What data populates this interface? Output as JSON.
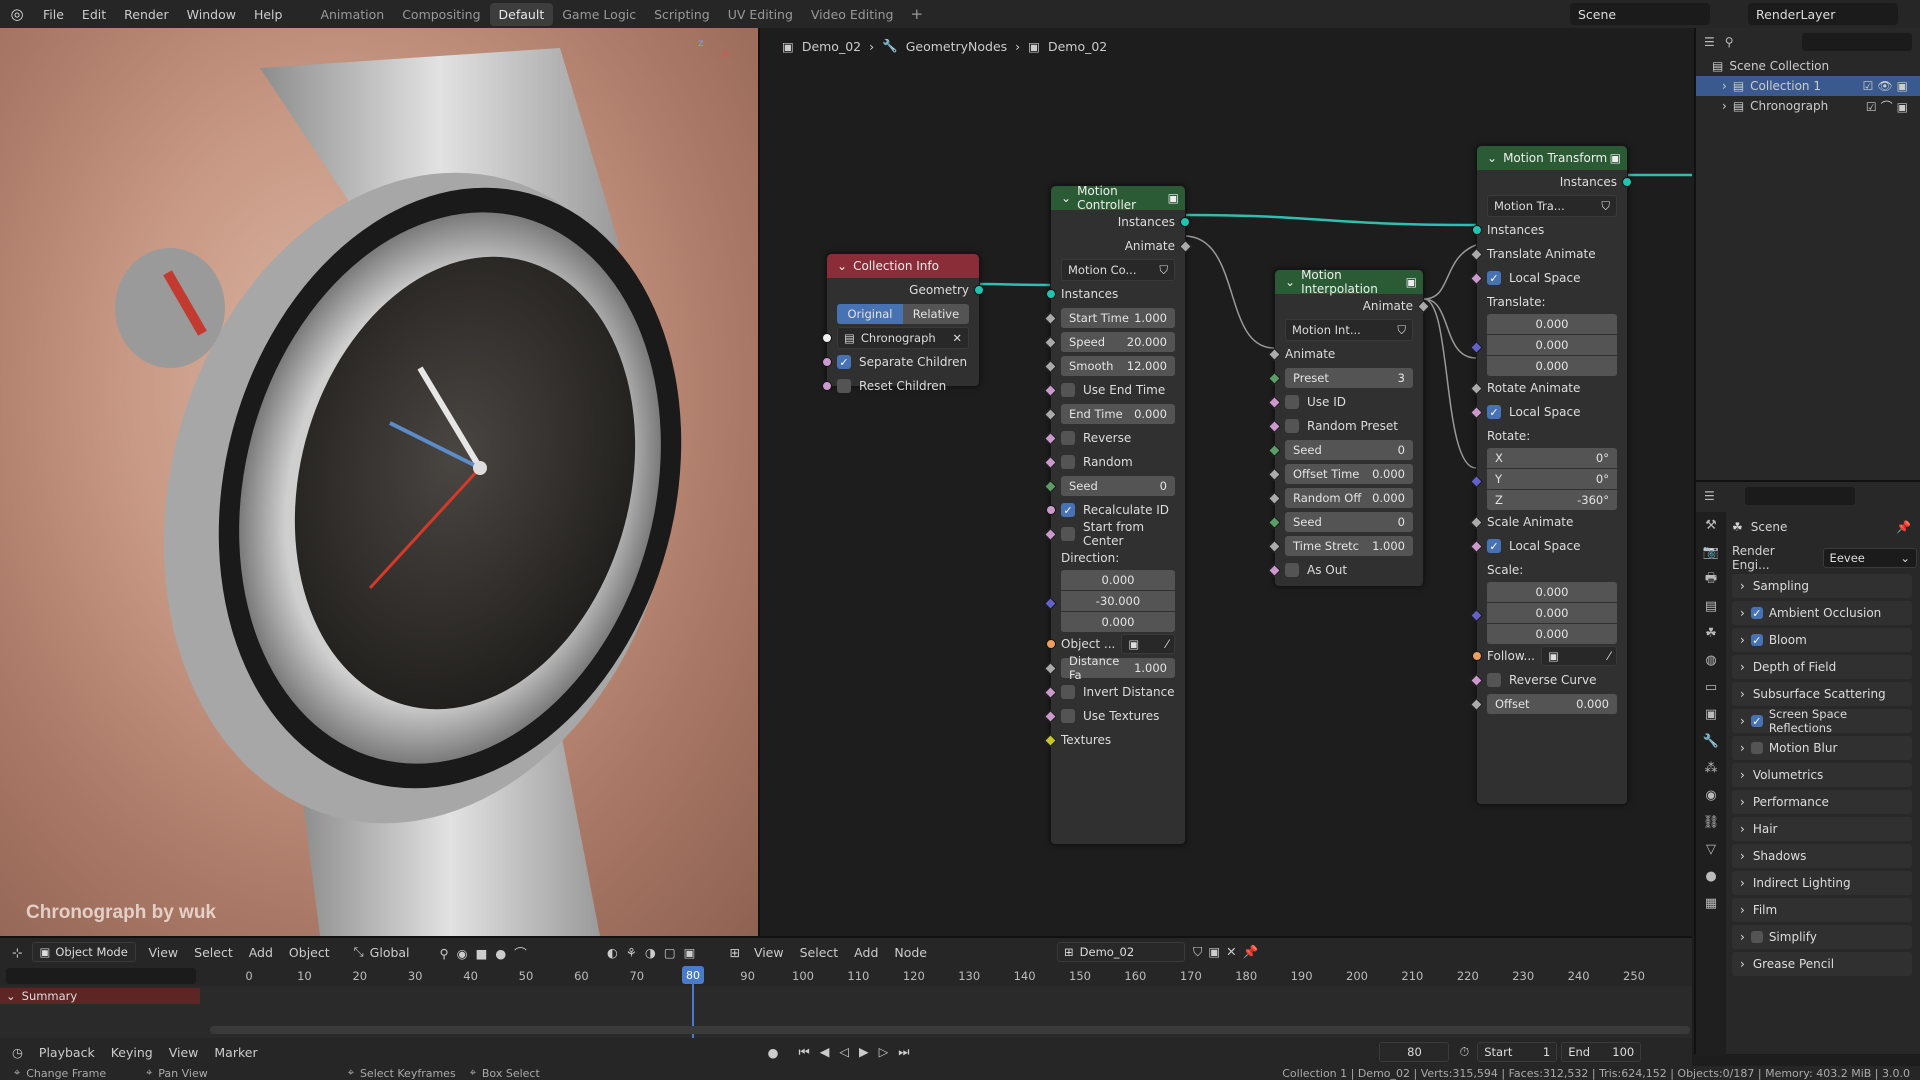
{
  "menu": {
    "items": [
      "File",
      "Edit",
      "Render",
      "Window",
      "Help"
    ]
  },
  "workspaces": [
    "Animation",
    "Compositing",
    "Default",
    "Game Logic",
    "Scripting",
    "UV Editing",
    "Video Editing"
  ],
  "active_workspace": "Default",
  "scene_name": "Scene",
  "render_layer": "RenderLayer",
  "viewport": {
    "credit": "Chronograph by wuk",
    "mode": "Object Mode",
    "menus": [
      "View",
      "Select",
      "Add",
      "Object"
    ],
    "transform": "Global"
  },
  "node_editor": {
    "breadcrumb": [
      "Demo_02",
      "GeometryNodes",
      "Demo_02"
    ],
    "menus": [
      "View",
      "Select",
      "Add",
      "Node"
    ],
    "tree_name": "Demo_02",
    "collection_info": {
      "title": "Collection Info",
      "geometry": "Geometry",
      "btn_original": "Original",
      "btn_relative": "Relative",
      "collection": "Chronograph",
      "separate_children": "Separate Children",
      "reset_children": "Reset Children"
    },
    "motion_controller": {
      "title": "Motion Controller",
      "instances": "Instances",
      "animate": "Animate",
      "group": "Motion Co...",
      "in_instances": "Instances",
      "start_time_l": "Start Time",
      "start_time": "1.000",
      "speed_l": "Speed",
      "speed": "20.000",
      "smooth_l": "Smooth",
      "smooth": "12.000",
      "use_end_time": "Use End Time",
      "end_time_l": "End Time",
      "end_time": "0.000",
      "reverse": "Reverse",
      "random": "Random",
      "seed_l": "Seed",
      "seed": "0",
      "recalc": "Recalculate ID",
      "start_center": "Start from Center",
      "direction": "Direction:",
      "dir_x": "0.000",
      "dir_y": "-30.000",
      "dir_z": "0.000",
      "object": "Object ...",
      "dist_l": "Distance Fa",
      "dist": "1.000",
      "invert": "Invert Distance",
      "use_tex": "Use Textures",
      "textures": "Textures"
    },
    "motion_interpolation": {
      "title": "Motion Interpolation",
      "animate_out": "Animate",
      "group": "Motion Int...",
      "animate_in": "Animate",
      "preset_l": "Preset",
      "preset": "3",
      "use_id": "Use ID",
      "random_preset": "Random Preset",
      "seed_l": "Seed",
      "seed": "0",
      "offset_l": "Offset Time",
      "offset": "0.000",
      "random_off_l": "Random Off",
      "random_off": "0.000",
      "seed2_l": "Seed",
      "seed2": "0",
      "stretch_l": "Time Stretc",
      "stretch": "1.000",
      "as_out": "As Out"
    },
    "motion_transform": {
      "title": "Motion Transform",
      "instances_out": "Instances",
      "group": "Motion Tra...",
      "instances_in": "Instances",
      "translate_anim": "Translate Animate",
      "local1": "Local Space",
      "translate": "Translate:",
      "t": [
        "0.000",
        "0.000",
        "0.000"
      ],
      "rotate_anim": "Rotate Animate",
      "local2": "Local Space",
      "rotate": "Rotate:",
      "rx_l": "X",
      "rx": "0°",
      "ry_l": "Y",
      "ry": "0°",
      "rz_l": "Z",
      "rz": "-360°",
      "scale_anim": "Scale Animate",
      "local3": "Local Space",
      "scale": "Scale:",
      "s": [
        "0.000",
        "0.000",
        "0.000"
      ],
      "follow": "Follow...",
      "reverse_curve": "Reverse Curve",
      "offset_l": "Offset",
      "offset": "0.000"
    }
  },
  "outliner": {
    "root": "Scene Collection",
    "items": [
      "Collection 1",
      "Chronograph"
    ]
  },
  "properties": {
    "scene": "Scene",
    "engine_label": "Render Engi...",
    "engine": "Eevee",
    "sections": [
      "Sampling",
      "Ambient Occlusion",
      "Bloom",
      "Depth of Field",
      "Subsurface Scattering",
      "Screen Space Reflections",
      "Motion Blur",
      "Volumetrics",
      "Performance",
      "Hair",
      "Shadows",
      "Indirect Lighting",
      "Film",
      "Simplify",
      "Grease Pencil"
    ]
  },
  "timeline": {
    "ticks": [
      "0",
      "10",
      "20",
      "30",
      "40",
      "50",
      "60",
      "70",
      "80",
      "90",
      "100",
      "110",
      "120",
      "130",
      "140",
      "150",
      "160",
      "170",
      "180",
      "190",
      "200",
      "210",
      "220",
      "230",
      "240",
      "250"
    ],
    "current_frame": "80",
    "summary": "Summary",
    "menus": [
      "Playback",
      "Keying",
      "View",
      "Marker"
    ],
    "frame": "80",
    "start_l": "Start",
    "start": "1",
    "end_l": "End",
    "end": "100"
  },
  "status": {
    "left": [
      "Change Frame",
      "Pan View",
      "Select Keyframes",
      "Box Select"
    ],
    "right": "Collection 1 | Demo_02 | Verts:315,594 | Faces:312,532 | Tris:624,152 | Objects:0/187 | Memory: 403.2 MiB | 3.0.0"
  }
}
